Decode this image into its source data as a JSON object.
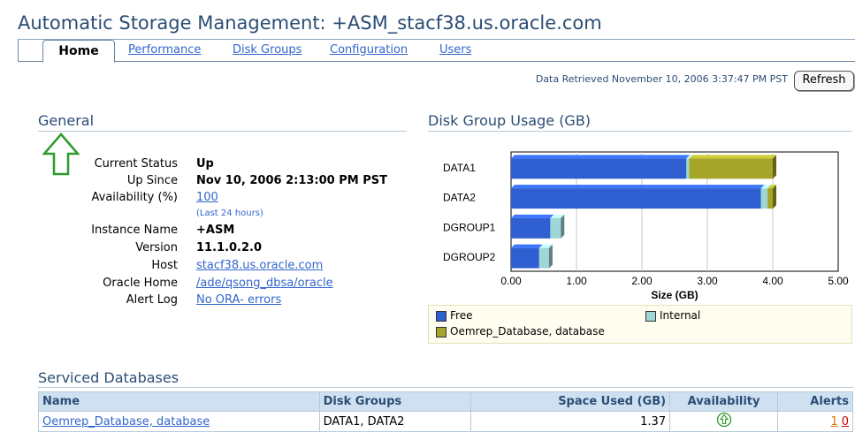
{
  "app": {
    "title": "Automatic Storage Management: +ASM_stacf38.us.oracle.com"
  },
  "tabs": [
    {
      "label": "Home"
    },
    {
      "label": "Performance"
    },
    {
      "label": "Disk Groups"
    },
    {
      "label": "Configuration"
    },
    {
      "label": "Users"
    }
  ],
  "header": {
    "retrieved": "Data Retrieved November 10, 2006 3:37:47 PM PST",
    "refresh_label": "Refresh"
  },
  "general": {
    "title": "General",
    "current_status_label": "Current Status",
    "current_status": "Up",
    "up_since_label": "Up Since",
    "up_since": "Nov 10, 2006 2:13:00 PM PST",
    "availability_label": "Availability (%)",
    "availability": "100",
    "availability_note": "(Last 24 hours)",
    "instance_name_label": "Instance Name",
    "instance_name": "+ASM",
    "version_label": "Version",
    "version": "11.1.0.2.0",
    "host_label": "Host",
    "host": "stacf38.us.oracle.com",
    "oracle_home_label": "Oracle Home",
    "oracle_home": "/ade/qsong_dbsa/oracle",
    "alert_log_label": "Alert Log",
    "alert_log": "No ORA- errors",
    "status_icon": "up-arrow-icon"
  },
  "disk_usage": {
    "title": "Disk Group Usage (GB)"
  },
  "chart_data": {
    "type": "bar",
    "orientation": "horizontal",
    "stacked": true,
    "categories": [
      "DATA1",
      "DATA2",
      "DGROUP1",
      "DGROUP2"
    ],
    "series": [
      {
        "name": "Free",
        "color": "#2f5fd0",
        "values": [
          2.68,
          3.82,
          0.6,
          0.43
        ]
      },
      {
        "name": "Internal",
        "color": "#9fd6d6",
        "values": [
          0.04,
          0.1,
          0.16,
          0.15
        ]
      },
      {
        "name": "Oemrep_Database, database",
        "color": "#a5a52a",
        "values": [
          1.28,
          0.08,
          0,
          0
        ]
      }
    ],
    "xlabel": "Size (GB)",
    "xlim": [
      0,
      5
    ],
    "ticks": [
      "0.00",
      "1.00",
      "2.00",
      "3.00",
      "4.00",
      "5.00"
    ],
    "grid": true,
    "legend": "bottom"
  },
  "serviced": {
    "title": "Serviced Databases",
    "columns": [
      "Name",
      "Disk Groups",
      "Space Used (GB)",
      "Availability",
      "Alerts"
    ],
    "rows": [
      {
        "name": "Oemrep_Database, database",
        "disk_groups": "DATA1, DATA2",
        "space_used": "1.37",
        "availability_icon": "up-arrow-icon",
        "alerts_warning": "1",
        "alerts_critical": "0"
      }
    ]
  }
}
